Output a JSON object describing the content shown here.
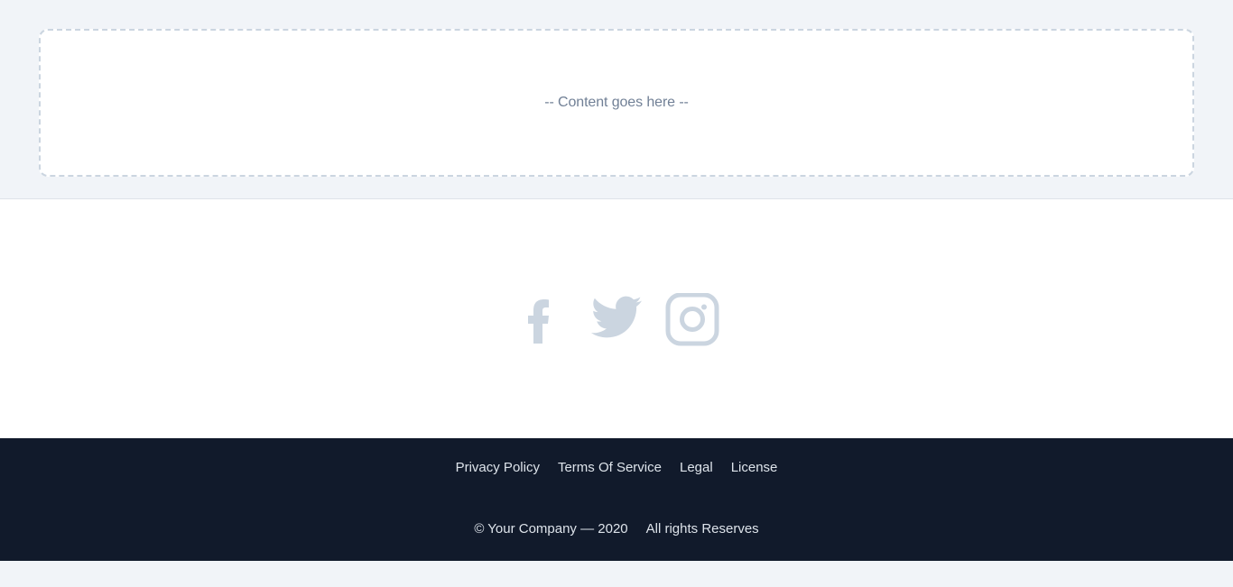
{
  "content": {
    "placeholder": "-- Content goes here --"
  },
  "social": {
    "icons": [
      "facebook-icon",
      "twitter-icon",
      "instagram-icon"
    ],
    "icon_color": "#cbd5e0"
  },
  "footer": {
    "links": [
      "Privacy Policy",
      "Terms Of Service",
      "Legal",
      "License"
    ],
    "copyright": "© Your Company — 2020",
    "rights": "All rights Reserves",
    "background": "#111a2b"
  }
}
